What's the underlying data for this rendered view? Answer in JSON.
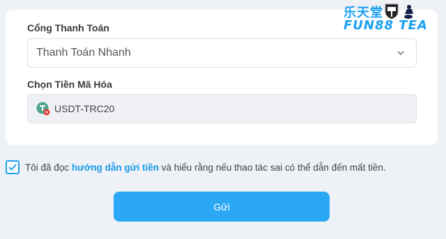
{
  "gateway": {
    "label": "Cổng Thanh Toán",
    "selected": "Thanh Toán Nhanh"
  },
  "coin": {
    "label": "Chọn Tiền Mã Hóa",
    "value": "USDT-TRC20",
    "icon": "tether-icon"
  },
  "brand": {
    "name_cn": "乐天堂",
    "name": "FUN88 TEA"
  },
  "agreement": {
    "checked": true,
    "prefix": "Tôi đã đọc",
    "link": "hướng dẫn gửi tiền",
    "suffix": "và hiểu rằng nếu thao tác sai có thể dẫn đến mất tiền."
  },
  "submit_label": "Gửi",
  "colors": {
    "accent": "#2ba8f5",
    "link": "#1a9be8",
    "background": "#eef1f5"
  }
}
